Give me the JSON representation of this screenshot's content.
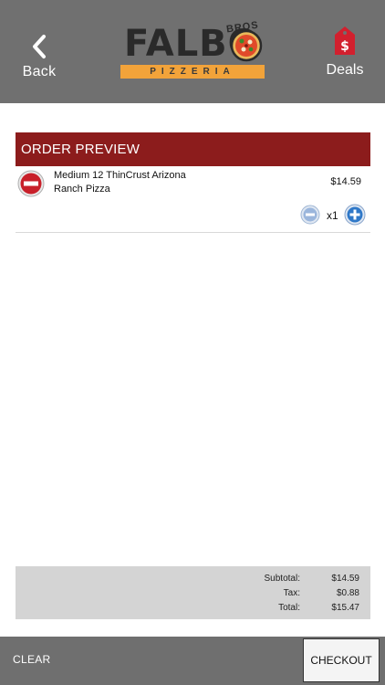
{
  "header": {
    "back_label": "Back",
    "deals_label": "Deals",
    "logo": {
      "word": "FALBO",
      "sub": "BROS",
      "band": "PIZZERIA"
    }
  },
  "order": {
    "title": "ORDER PREVIEW",
    "items": [
      {
        "name": "Medium 12 ThinCrust Arizona Ranch Pizza",
        "price": "$14.59",
        "quantity": "x1"
      }
    ]
  },
  "totals": [
    {
      "label": "Subtotal:",
      "value": "$14.59"
    },
    {
      "label": "Tax:",
      "value": "$0.88"
    },
    {
      "label": "Total:",
      "value": "$15.47"
    }
  ],
  "footer": {
    "clear_label": "CLEAR",
    "checkout_label": "CHECKOUT"
  },
  "colors": {
    "header_bg": "#707070",
    "section_red": "#8c1c1c",
    "logo_orange": "#f2a33a",
    "deals_red": "#d2202e",
    "qty_blue": "#2f78c8"
  }
}
